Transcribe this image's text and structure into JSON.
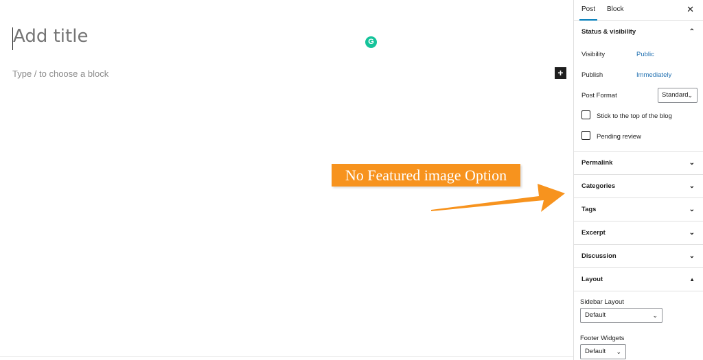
{
  "editor": {
    "title_placeholder": "Add title",
    "block_hint": "Type / to choose a block",
    "add_block_symbol": "+",
    "grammarly_glyph": "G"
  },
  "annotation": {
    "text": "No Featured image Option",
    "color": "#f7931e"
  },
  "sidebar": {
    "tabs": [
      {
        "label": "Post",
        "active": true
      },
      {
        "label": "Block",
        "active": false
      }
    ],
    "close_symbol": "✕",
    "status": {
      "title": "Status & visibility",
      "visibility_label": "Visibility",
      "visibility_value": "Public",
      "publish_label": "Publish",
      "publish_value": "Immediately",
      "post_format_label": "Post Format",
      "post_format_value": "Standard",
      "stick_label": "Stick to the top of the blog",
      "pending_label": "Pending review"
    },
    "panels": [
      {
        "title": "Permalink"
      },
      {
        "title": "Categories"
      },
      {
        "title": "Tags"
      },
      {
        "title": "Excerpt"
      },
      {
        "title": "Discussion"
      },
      {
        "title": "Layout"
      }
    ],
    "layout": {
      "sidebar_layout_label": "Sidebar Layout",
      "sidebar_layout_value": "Default",
      "footer_widgets_label": "Footer Widgets",
      "footer_widgets_value": "Default"
    },
    "accent_color": "#007cba",
    "link_color": "#2271b1"
  }
}
